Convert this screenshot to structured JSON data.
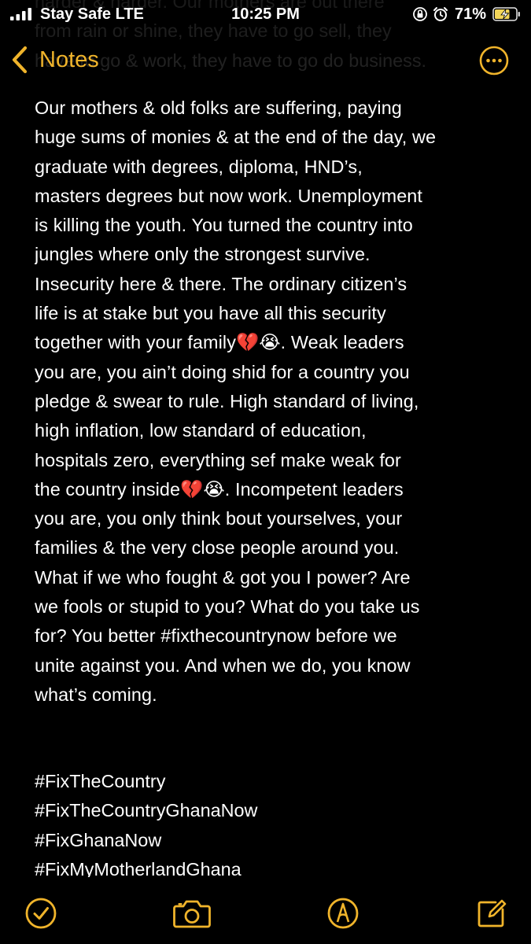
{
  "status_bar": {
    "carrier": "Stay Safe  LTE",
    "time": "10:25 PM",
    "battery_percent": "71%",
    "icons": [
      "signal-bars-icon",
      "orientation-lock-icon",
      "alarm-icon",
      "battery-charging-icon"
    ]
  },
  "nav": {
    "back_label": "Notes",
    "back_icon": "chevron-left-icon",
    "more_icon": "ellipsis-circle-icon",
    "accent_color": "#f0b42b"
  },
  "note": {
    "ghost_text": "harder & harder. Our mothers are out there\nfrom rain or shine, they have to go sell, they\nhave to go & work, they have to go do business.",
    "body": "Our mothers & old folks are suffering, paying\nhuge sums of monies & at the end of the day, we\ngraduate with degrees, diploma, HND’s,\nmasters degrees but now work. Unemployment\nis killing the youth. You turned  the country into\njungles where only the strongest survive.\nInsecurity here & there. The ordinary citizen’s\nlife is at stake but you have all this security\ntogether with your family💔😭. Weak leaders\nyou are, you ain’t doing shid for a country you\npledge & swear to rule. High standard of living,\nhigh inflation, low standard of education,\nhospitals zero, everything sef make weak for\nthe country inside💔😭. Incompetent leaders\nyou are, you only think bout yourselves, your\nfamilies & the very close people around you.\nWhat if we who fought & got you I power? Are\nwe fools or stupid to you? What do you take us\nfor? You better #fixthecountrynow before we\nunite against you. And when we do, you know\nwhat’s coming.",
    "hashtags": [
      "#FixTheCountry",
      "#FixTheCountryGhanaNow",
      "#FixGhanaNow",
      "#FixMyMotherlandGhana"
    ]
  },
  "toolbar": {
    "items": [
      "checklist-icon",
      "camera-icon",
      "markup-pen-icon",
      "compose-icon"
    ]
  }
}
